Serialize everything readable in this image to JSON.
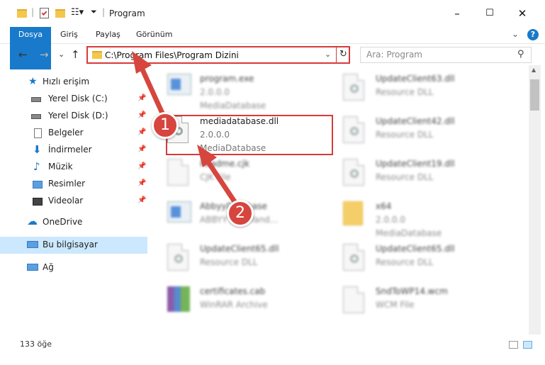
{
  "window": {
    "title": "Program",
    "minimize": "–",
    "maximize": "☐",
    "close": "✕"
  },
  "ribbon": {
    "tabs": [
      "Dosya",
      "Giriş",
      "Paylaş",
      "Görünüm"
    ],
    "expand": "⌄",
    "help": "?"
  },
  "nav": {
    "back": "←",
    "forward": "→",
    "recent": "⌄",
    "up": "↑",
    "address": "C:\\Program Files\\Program Dizini",
    "address_dropdown": "⌄",
    "refresh": "↻",
    "search_placeholder": "Ara: Program",
    "search_icon": "⚲"
  },
  "sidebar": {
    "items": [
      {
        "label": "Hızlı erişim",
        "icon": "star-icon",
        "pinned": false
      },
      {
        "label": "Yerel Disk (C:)",
        "icon": "drive-icon",
        "pinned": true
      },
      {
        "label": "Yerel Disk (D:)",
        "icon": "drive-icon",
        "pinned": true
      },
      {
        "label": "Belgeler",
        "icon": "documents-icon",
        "pinned": true
      },
      {
        "label": "İndirmeler",
        "icon": "download-icon",
        "pinned": true
      },
      {
        "label": "Müzik",
        "icon": "music-icon",
        "pinned": true
      },
      {
        "label": "Resimler",
        "icon": "pictures-icon",
        "pinned": true
      },
      {
        "label": "Videolar",
        "icon": "videos-icon",
        "pinned": true
      },
      {
        "label": "OneDrive",
        "icon": "cloud-icon",
        "pinned": false
      },
      {
        "label": "Bu bilgisayar",
        "icon": "computer-icon",
        "pinned": false,
        "selected": true
      },
      {
        "label": "Ağ",
        "icon": "network-icon",
        "pinned": false
      }
    ]
  },
  "files": [
    {
      "name": "program.exe",
      "meta1": "2.0.0.0",
      "meta2": "MediaDatabase",
      "icon": "app-icon"
    },
    {
      "name": "UpdateClient63.dll",
      "meta1": "Resource DLL",
      "meta2": "",
      "icon": "dll-icon"
    },
    {
      "name": "mediadatabase.dll",
      "meta1": "2.0.0.0",
      "meta2": "MediaDatabase",
      "icon": "dll-icon"
    },
    {
      "name": "UpdateClient42.dll",
      "meta1": "Resource DLL",
      "meta2": "",
      "icon": "dll-icon"
    },
    {
      "name": "Readme.cjk",
      "meta1": "CJK File",
      "meta2": "",
      "icon": "file-icon"
    },
    {
      "name": "UpdateClient19.dll",
      "meta1": "Resource DLL",
      "meta2": "",
      "icon": "dll-icon"
    },
    {
      "name": "AbbyyDatabase",
      "meta1": "ABBYY Fast Yand...",
      "meta2": "",
      "icon": "app-icon"
    },
    {
      "name": "x64",
      "meta1": "2.0.0.0",
      "meta2": "MediaDatabase",
      "icon": "folder-icon"
    },
    {
      "name": "UpdateClient65.dll",
      "meta1": "Resource DLL",
      "meta2": "",
      "icon": "dll-icon"
    },
    {
      "name": "UpdateClient65.dll",
      "meta1": "Resource DLL",
      "meta2": "",
      "icon": "dll-icon"
    },
    {
      "name": "certificates.cab",
      "meta1": "WinRAR Archive",
      "meta2": "",
      "icon": "archive-icon"
    },
    {
      "name": "SndToWP14.wcm",
      "meta1": "WCM File",
      "meta2": "",
      "icon": "file-icon"
    }
  ],
  "status": {
    "count": "133 öğe"
  },
  "annotations": {
    "step1": "1",
    "step2": "2",
    "color": "#d6463e"
  }
}
